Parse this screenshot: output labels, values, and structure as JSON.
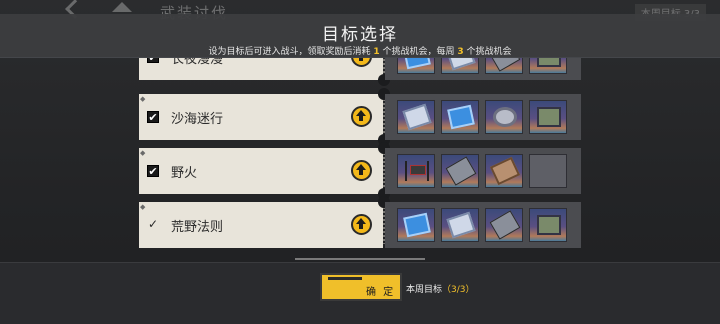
{
  "background": {
    "title": "武装讨伐",
    "right_badge": "本周目标 3/3"
  },
  "modal": {
    "title": "目标选择",
    "subtitle_pre": "设为目标后可进入战斗，领取奖励后消耗",
    "subtitle_n1": "1",
    "subtitle_mid": "个挑战机会，每周",
    "subtitle_n2": "3",
    "subtitle_post": "个挑战机会"
  },
  "rows": [
    {
      "name": "长夜漫漫",
      "checked": true,
      "slots": [
        "blue",
        "tablet",
        "gun",
        "mech"
      ]
    },
    {
      "name": "沙海迷行",
      "checked": true,
      "slots": [
        "tablet",
        "blue",
        "gear",
        "mech"
      ]
    },
    {
      "name": "野火",
      "checked": true,
      "slots": [
        "spider",
        "gun",
        "brown",
        "empty"
      ]
    },
    {
      "name": "荒野法则",
      "checked": false,
      "slots": [
        "blue",
        "tablet",
        "gun",
        "mech"
      ]
    }
  ],
  "footer": {
    "confirm_label": "确 定",
    "weekly_label": "本周目标",
    "weekly_count": "（3/3）"
  },
  "colors": {
    "accent": "#f2c02a",
    "card": "#e8e4da",
    "panel": "#4b4c50"
  }
}
